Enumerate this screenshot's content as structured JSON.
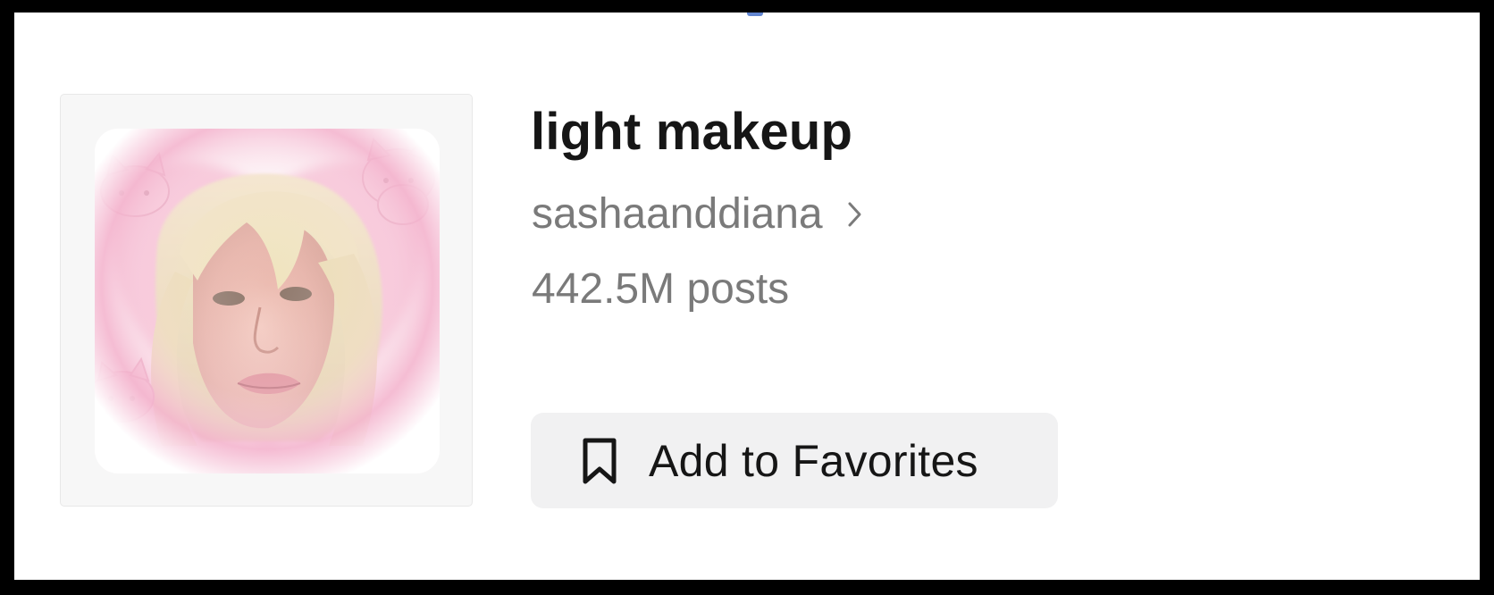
{
  "collection": {
    "title": "light makeup",
    "creator": "sashaanddiana",
    "post_count": "442.5M posts",
    "favorite_button_label": "Add to Favorites"
  },
  "icons": {
    "creator_arrow": "chevron-right-icon",
    "favorite": "bookmark-icon"
  },
  "colors": {
    "title_text": "#161616",
    "secondary_text": "#7a7a7a",
    "button_background": "#f1f1f2",
    "cover_accent": "#f4b6cf"
  }
}
